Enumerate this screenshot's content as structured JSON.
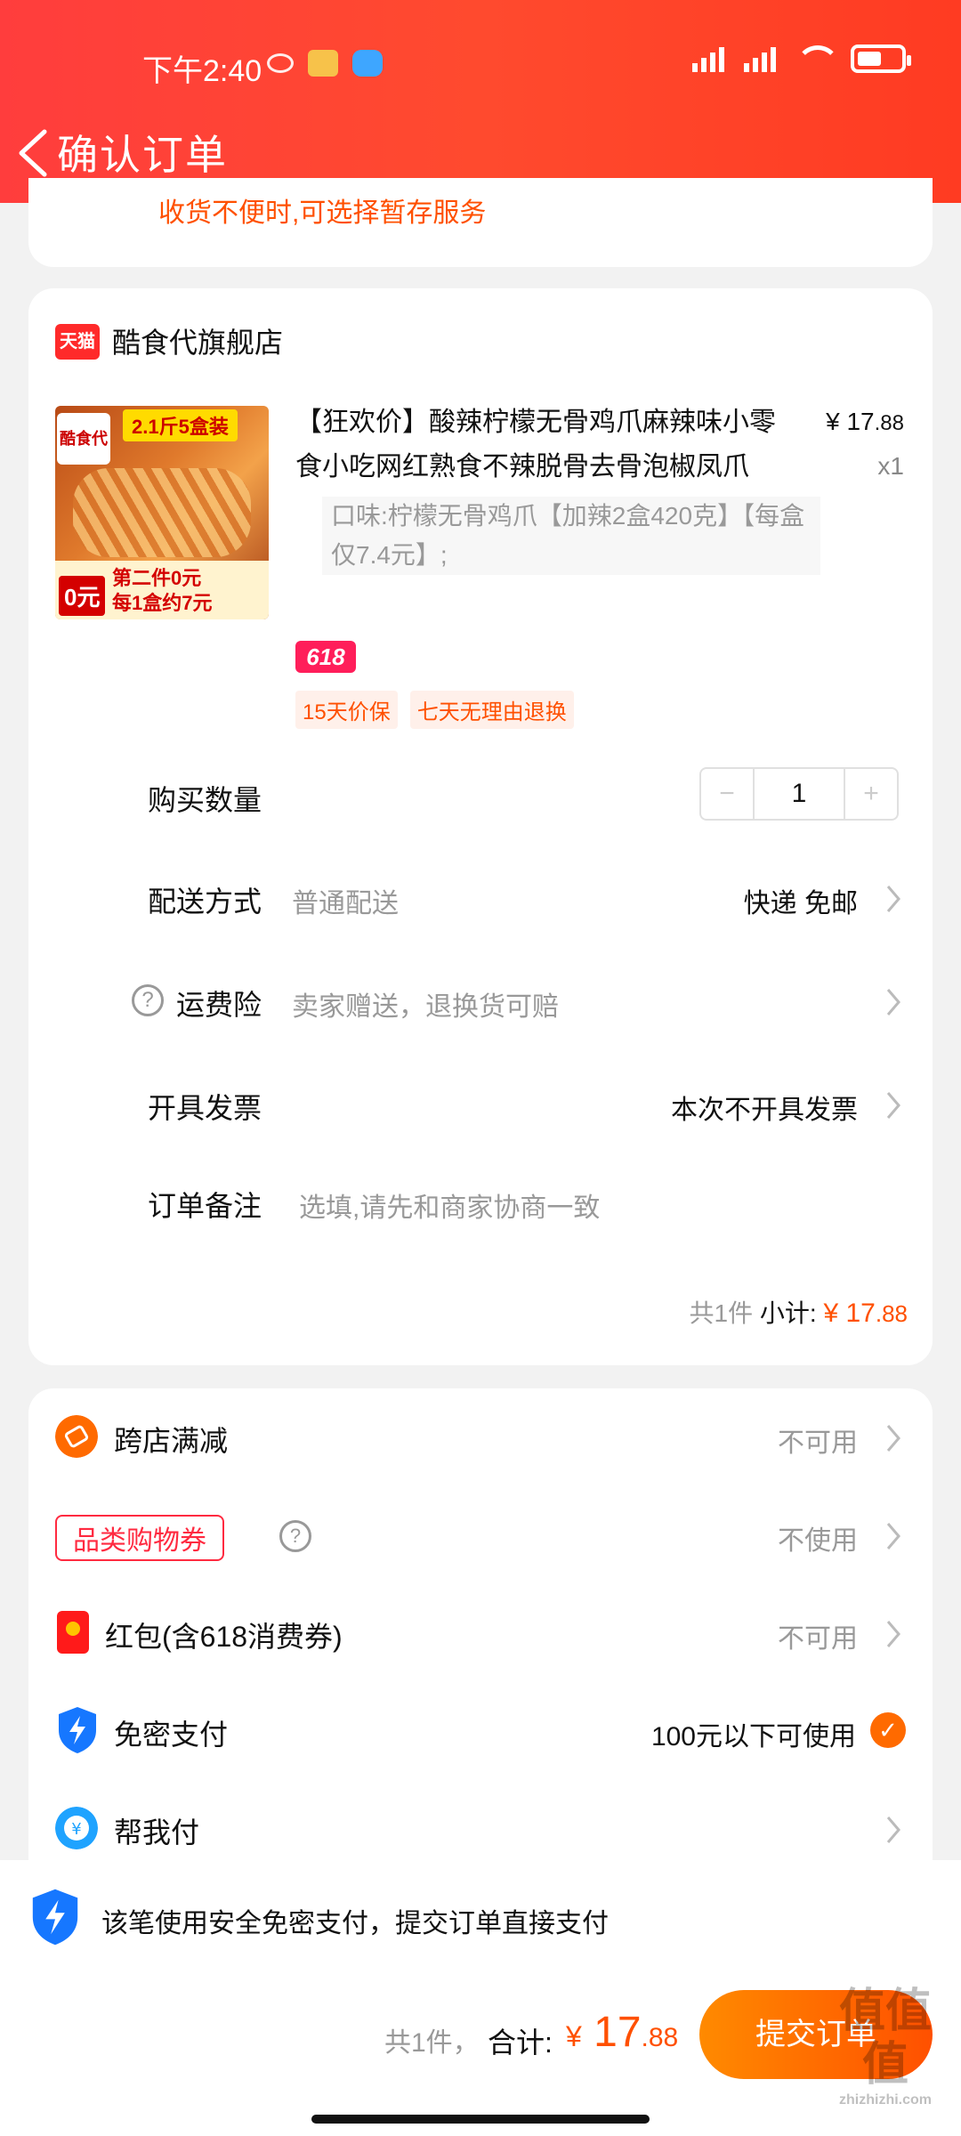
{
  "status": {
    "time": "下午2:40"
  },
  "nav": {
    "title": "确认订单"
  },
  "notice_top": "收货不便时,可选择暂存服务",
  "shop": {
    "logo_text": "天猫",
    "name": "酷食代旗舰店"
  },
  "product": {
    "image_badge": "2.1斤5盒装",
    "image_logo": "酷食代",
    "image_zero": "0元",
    "image_promo_line1": "第二件0元",
    "image_promo_line2": "每1盒约7元",
    "title": "【狂欢价】酸辣柠檬无骨鸡爪麻辣味小零食小吃网红熟食不辣脱骨去骨泡椒凤爪",
    "price_symbol": "¥",
    "price_int": "17",
    "price_dec": ".88",
    "qty": "x1",
    "spec": "口味:柠檬无骨鸡爪【加辣2盒420克】【每盒仅7.4元】;",
    "tag_618": "618",
    "service_tags": [
      "15天价保",
      "七天无理由退换"
    ]
  },
  "rows": {
    "quantity": {
      "label": "购买数量",
      "value": "1",
      "minus": "−",
      "plus": "+"
    },
    "delivery": {
      "label": "配送方式",
      "sub": "普通配送",
      "right": "快递 免邮"
    },
    "insurance": {
      "label": "运费险",
      "sub": "卖家赠送，退换货可赔"
    },
    "invoice": {
      "label": "开具发票",
      "right": "本次不开具发票"
    },
    "note": {
      "label": "订单备注",
      "placeholder": "选填,请先和商家协商一致"
    }
  },
  "subtotal": {
    "count": "共1件",
    "label": "小计:",
    "symbol": "¥",
    "int": "17",
    "dec": ".88"
  },
  "payment": {
    "cross_store": {
      "label": "跨店满减",
      "right": "不可用"
    },
    "category_coupon": {
      "label": "品类购物券",
      "right": "不使用"
    },
    "red_packet": {
      "label": "红包(含618消费券)",
      "right": "不可用"
    },
    "password_free": {
      "label": "免密支付",
      "right": "100元以下可使用"
    },
    "pay_for_me": {
      "label": "帮我付"
    }
  },
  "bottom": {
    "notice": "该笔使用安全免密支付，提交订单直接支付",
    "count": "共1件，",
    "total_label": "合计:",
    "total_symbol": "¥",
    "total_int": "17",
    "total_dec": ".88",
    "submit": "提交订单"
  },
  "watermark": {
    "text": "值值值",
    "sub": "zhizhizhi.com"
  },
  "colors": {
    "header": "#ff3d3d",
    "accent": "#ff5000",
    "submit_start": "#ff8a00",
    "submit_end": "#ff5000"
  }
}
